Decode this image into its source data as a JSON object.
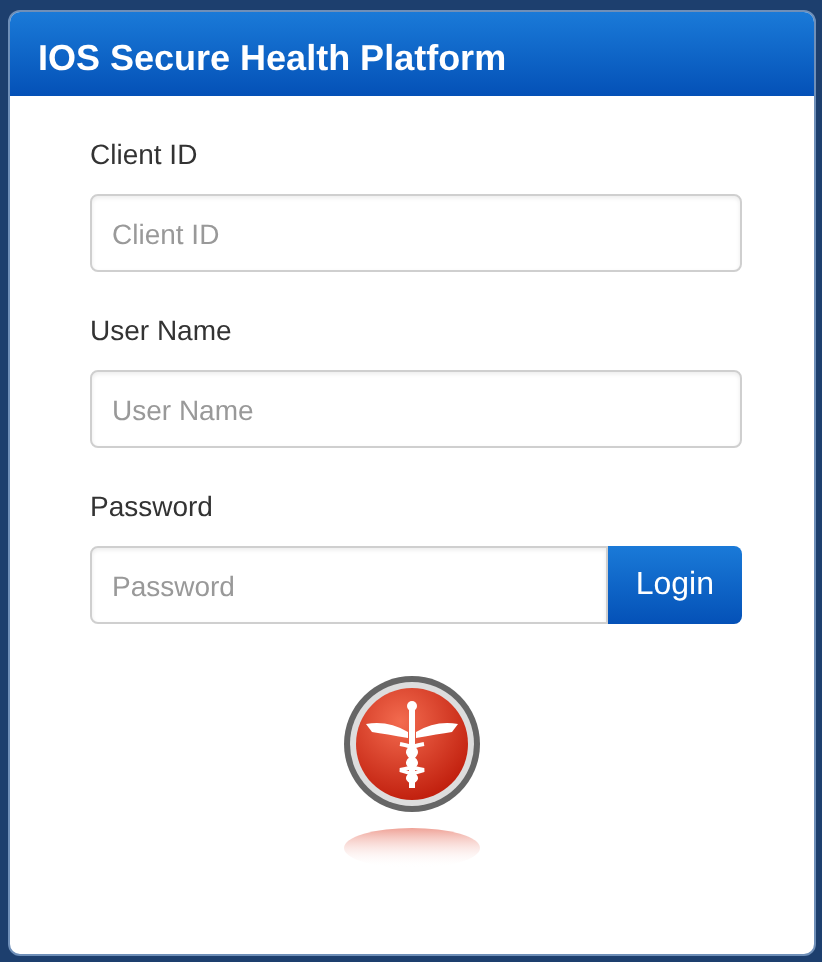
{
  "panel": {
    "title": "IOS Secure Health Platform"
  },
  "fields": [
    {
      "label": "Client ID",
      "placeholder": "Client ID",
      "kind": "text"
    },
    {
      "label": "User Name",
      "placeholder": "User Name",
      "kind": "text"
    },
    {
      "label": "Password",
      "placeholder": "Password",
      "kind": "password"
    }
  ],
  "login_button": "Login"
}
